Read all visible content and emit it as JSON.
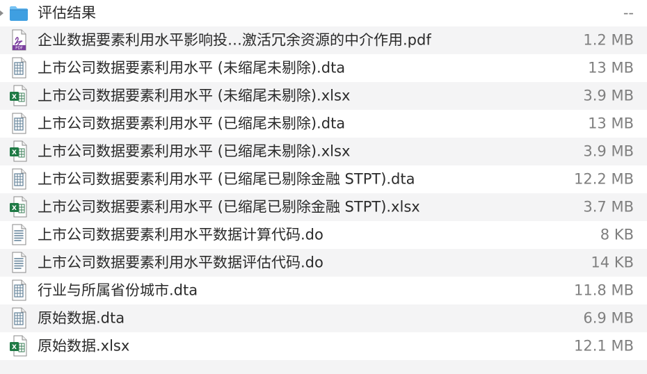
{
  "file_list": {
    "rows": [
      {
        "name": "评估结果",
        "size": "--",
        "type": "folder",
        "icon": "folder-icon"
      },
      {
        "name": "企业数据要素利用水平影响投…激活冗余资源的中介作用.pdf",
        "size": "1.2 MB",
        "type": "pdf",
        "icon": "pdf-file-icon"
      },
      {
        "name": "上市公司数据要素利用水平 (未缩尾未剔除).dta",
        "size": "13 MB",
        "type": "dta",
        "icon": "dta-file-icon"
      },
      {
        "name": "上市公司数据要素利用水平 (未缩尾未剔除).xlsx",
        "size": "3.9 MB",
        "type": "xlsx",
        "icon": "excel-file-icon"
      },
      {
        "name": "上市公司数据要素利用水平 (已缩尾未剔除).dta",
        "size": "13 MB",
        "type": "dta",
        "icon": "dta-file-icon"
      },
      {
        "name": "上市公司数据要素利用水平 (已缩尾未剔除).xlsx",
        "size": "3.9 MB",
        "type": "xlsx",
        "icon": "excel-file-icon"
      },
      {
        "name": "上市公司数据要素利用水平 (已缩尾已剔除金融 STPT).dta",
        "size": "12.2 MB",
        "type": "dta",
        "icon": "dta-file-icon"
      },
      {
        "name": "上市公司数据要素利用水平 (已缩尾已剔除金融 STPT).xlsx",
        "size": "3.7 MB",
        "type": "xlsx",
        "icon": "excel-file-icon"
      },
      {
        "name": "上市公司数据要素利用水平数据计算代码.do",
        "size": "8 KB",
        "type": "do",
        "icon": "do-file-icon"
      },
      {
        "name": "上市公司数据要素利用水平数据评估代码.do",
        "size": "14 KB",
        "type": "do",
        "icon": "do-file-icon"
      },
      {
        "name": "行业与所属省份城市.dta",
        "size": "11.8 MB",
        "type": "dta",
        "icon": "dta-file-icon"
      },
      {
        "name": "原始数据.dta",
        "size": "6.9 MB",
        "type": "dta",
        "icon": "dta-file-icon"
      },
      {
        "name": "原始数据.xlsx",
        "size": "12.1 MB",
        "type": "xlsx",
        "icon": "excel-file-icon"
      }
    ]
  },
  "icons": {
    "pdf_badge": "PDF",
    "excel_badge": "X"
  },
  "colors": {
    "folder_blue": "#4aa8e8",
    "pdf_purple": "#7b3f9f",
    "excel_green": "#1f7a45",
    "document_gray_blue": "#5f7f96"
  }
}
